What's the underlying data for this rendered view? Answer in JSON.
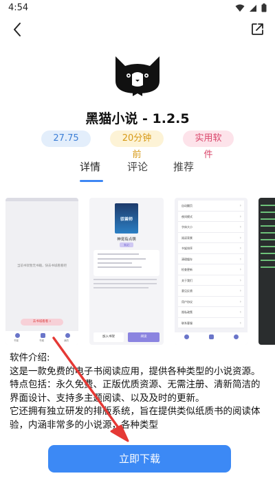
{
  "status": {
    "time": "4:54"
  },
  "app": {
    "title": "黑猫小说 - 1.2.5"
  },
  "badges": {
    "rating": "27.75",
    "updated": "20分钟前",
    "category": "实用软件"
  },
  "tabs": [
    "详情",
    "评论",
    "推荐"
  ],
  "screenshots": {
    "shot1": {
      "empty_text": "当前书架暂无书籍，快去书城看看吧",
      "search_label": "去书城看看",
      "nav": [
        "书架",
        "书城",
        "我的"
      ]
    },
    "shot2": {
      "book_title": "驭兽师",
      "book_subtitle": "神宠有点萌",
      "book_line": "深度阅读免费看正版",
      "tag": "玄幻",
      "add_shelf": "加入书架",
      "read_now": "阅读"
    },
    "shot3": {
      "items": [
        "自动翻页",
        "夜间模式",
        "字体大小",
        "阅读背景",
        "书架排序",
        "清理缓存",
        "检查更新",
        "关于我们",
        "意见反馈",
        "用户协议",
        "隐私政策",
        "联系客服"
      ],
      "nav": [
        "书架",
        "书城",
        "我的"
      ]
    }
  },
  "description": {
    "heading": "软件介绍:",
    "lines": [
      "这是一款免费的电子书阅读应用，提供各种类型的小说资源。",
      "特点包括：永久免费、正版优质资源、无需注册、清新简洁的",
      "界面设计、支持多主题阅读、以及及时的更新。",
      "它还拥有独立研发的排版系统，旨在提供类似纸质书的阅读体",
      "验，内涵非常多的小说源，各种类型"
    ]
  },
  "download": {
    "label": "立即下载"
  },
  "colors": {
    "accent": "#3c89f5",
    "arrow": "#e53935"
  }
}
